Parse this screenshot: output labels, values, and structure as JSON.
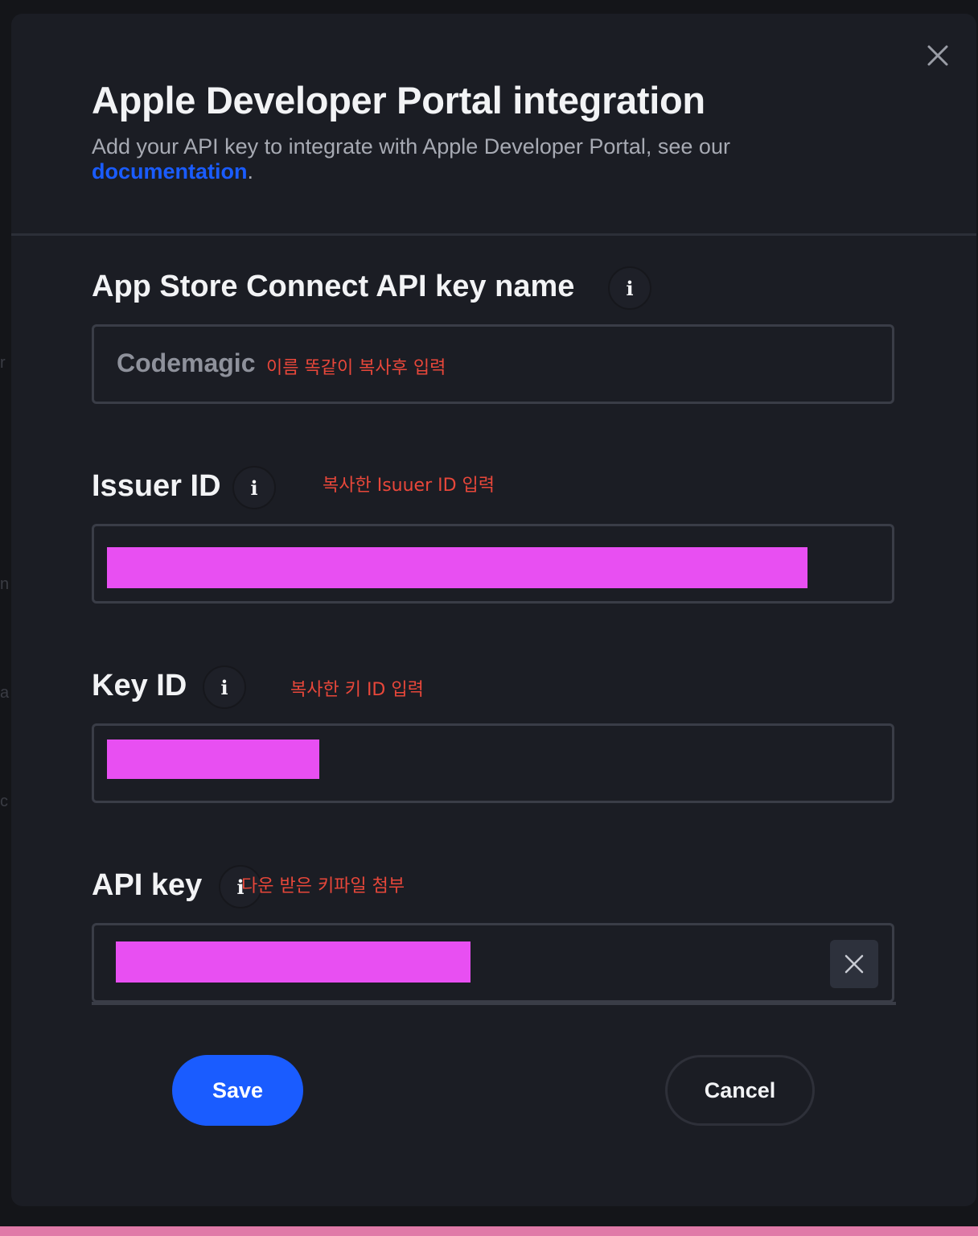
{
  "modal": {
    "title": "Apple Developer Portal integration",
    "subtitle": "Add your API key to integrate with Apple Developer Portal, see our",
    "doc_link": "documentation",
    "doc_suffix": ".",
    "info_glyph": "i"
  },
  "fields": {
    "key_name": {
      "label": "App Store Connect API key name",
      "value": "Codemagic",
      "note": "이름 똑같이 복사후 입력"
    },
    "issuer_id": {
      "label": "Issuer ID",
      "note": "복사한 Isuuer ID 입력"
    },
    "key_id": {
      "label": "Key ID",
      "note": "복사한 키 ID 입력"
    },
    "api_key": {
      "label": "API key",
      "note": "다운 받은 키파일 첨부"
    }
  },
  "buttons": {
    "save": "Save",
    "cancel": "Cancel"
  },
  "colors": {
    "background": "#1b1d24",
    "accent": "#1a5cff",
    "annotation": "#e8473a",
    "redaction": "#e84ff2"
  }
}
